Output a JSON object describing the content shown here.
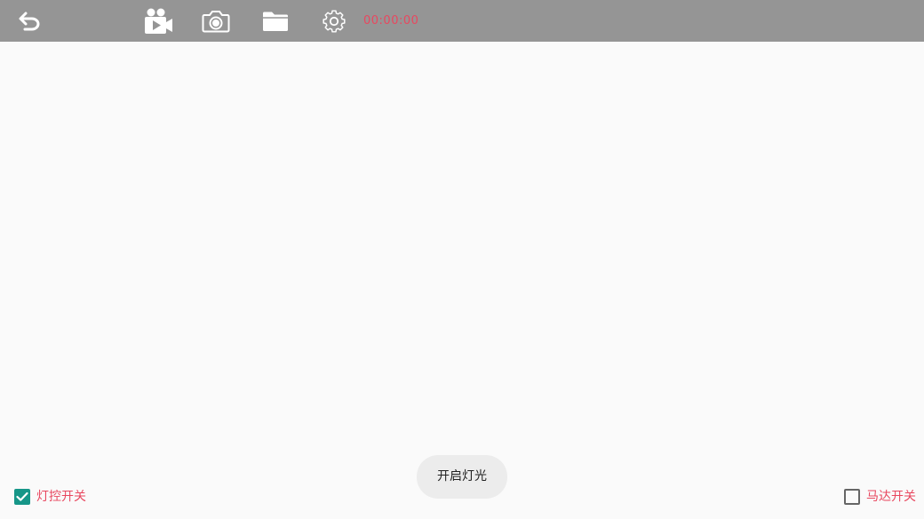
{
  "toolbar": {
    "timer": "00:00:00",
    "icons": [
      "back-arrow-icon",
      "video-camera-icon",
      "camera-icon",
      "folder-icon",
      "gear-icon"
    ]
  },
  "toast": {
    "text": "开启灯光"
  },
  "controls": {
    "light_switch": {
      "label": "灯控开关",
      "checked": true
    },
    "motor_switch": {
      "label": "马达开关",
      "checked": false
    }
  },
  "colors": {
    "toolbar_bg": "#959595",
    "accent": "#169688",
    "label_red": "#e8475f",
    "background": "#fafafa"
  }
}
